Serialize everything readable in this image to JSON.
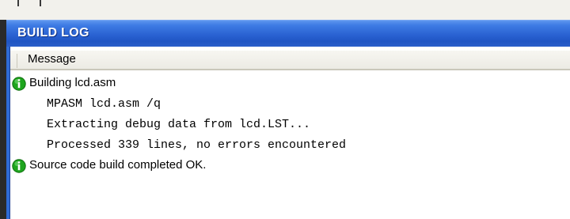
{
  "window": {
    "title": "BUILD LOG"
  },
  "table": {
    "column_header": "Message"
  },
  "log": [
    {
      "kind": "info",
      "icon": "info-icon",
      "text": "Building lcd.asm"
    },
    {
      "kind": "detail",
      "text": "MPASM lcd.asm /q"
    },
    {
      "kind": "detail",
      "text": "Extracting debug data from lcd.LST..."
    },
    {
      "kind": "detail",
      "text": "Processed 339 lines, no errors encountered"
    },
    {
      "kind": "info",
      "icon": "info-icon",
      "text": "Source code build completed OK."
    }
  ],
  "colors": {
    "title_bar": "#2a62d2",
    "title_text": "#ffffff",
    "info_icon": "#1ea51e"
  }
}
